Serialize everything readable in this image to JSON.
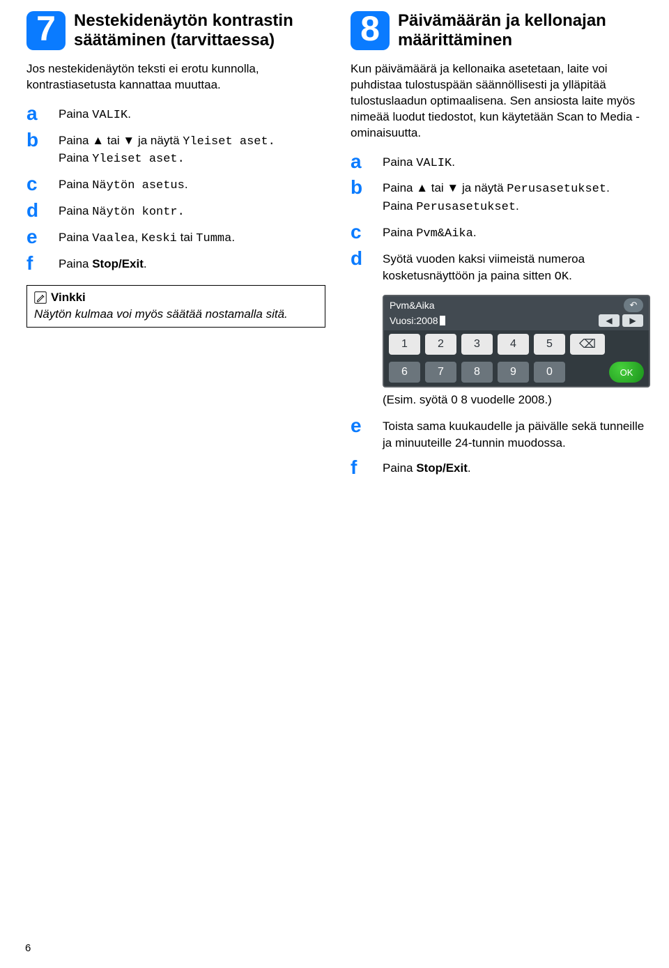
{
  "left": {
    "stepNumber": "7",
    "title": "Nestekidenäytön kontrastin säätäminen (tarvittaessa)",
    "intro": "Jos nestekidenäytön teksti ei erotu kunnolla, kontrastiasetusta kannattaa muuttaa.",
    "steps": {
      "a": {
        "pre": "Paina ",
        "mono": "VALIK",
        "post": "."
      },
      "b": {
        "line1_pre": "Paina ▲ tai ▼ ja näytä ",
        "line1_mono": "Yleiset aset.",
        "line1_post": "",
        "line2_pre": "Paina ",
        "line2_mono": "Yleiset aset.",
        "line2_post": ""
      },
      "c": {
        "pre": "Paina ",
        "mono": "Näytön asetus",
        "post": "."
      },
      "d": {
        "pre": "Paina ",
        "mono": "Näytön kontr.",
        "post": ""
      },
      "e": {
        "pre": "Paina ",
        "m1": "Vaalea",
        "sep1": ", ",
        "m2": "Keski",
        "sep2": " tai ",
        "m3": "Tumma",
        "post": "."
      },
      "f": {
        "pre": "Paina ",
        "strong": "Stop/Exit",
        "post": "."
      }
    },
    "tip": {
      "title": "Vinkki",
      "body": "Näytön kulmaa voi myös säätää nostamalla sitä."
    }
  },
  "right": {
    "stepNumber": "8",
    "title": "Päivämäärän ja kellonajan määrittäminen",
    "intro": "Kun päivämäärä ja kellonaika asetetaan, laite voi puhdistaa tulostuspään säännöllisesti ja ylläpitää tulostuslaadun optimaalisena. Sen ansiosta laite myös nimeää luodut tiedostot, kun käytetään Scan to Media -ominaisuutta.",
    "steps": {
      "a": {
        "pre": "Paina ",
        "mono": "VALIK",
        "post": "."
      },
      "b": {
        "line1_pre": "Paina ▲ tai ▼ ja näytä ",
        "line1_mono": "Perusasetukset",
        "line1_post": ".",
        "line2_pre": "Paina ",
        "line2_mono": "Perusasetukset",
        "line2_post": "."
      },
      "c": {
        "pre": "Paina ",
        "mono": "Pvm&Aika",
        "post": "."
      },
      "d": {
        "line1": "Syötä vuoden kaksi viimeistä numeroa kosketusnäyttöön ja paina sitten ",
        "mono": "OK",
        "post": "."
      },
      "e": {
        "text": "Toista sama kuukaudelle ja päivälle sekä tunneille ja minuuteille 24-tunnin muodossa."
      },
      "f": {
        "pre": "Paina ",
        "strong": "Stop/Exit",
        "post": "."
      }
    },
    "keypad": {
      "header": "Pvm&Aika",
      "sub": "Vuosi:2008",
      "row1": [
        "1",
        "2",
        "3",
        "4",
        "5"
      ],
      "row2": [
        "6",
        "7",
        "8",
        "9",
        "0"
      ],
      "ok": "OK"
    },
    "caption": "(Esim. syötä 0 8 vuodelle 2008.)"
  },
  "pageNumber": "6"
}
